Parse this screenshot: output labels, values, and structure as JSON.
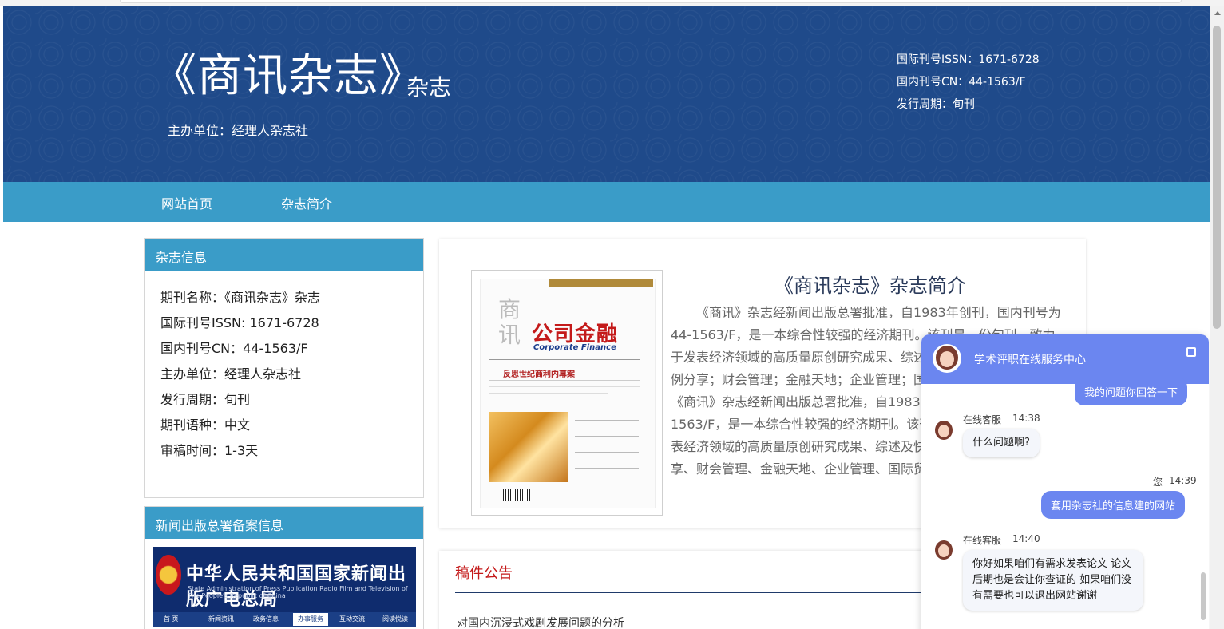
{
  "header": {
    "title": "《商讯杂志》",
    "title_suffix": "杂志",
    "sponsor": "主办单位：经理人杂志社",
    "issn": "国际刊号ISSN：1671-6728",
    "cn": "国内刊号CN：44-1563/F",
    "cycle": "发行周期：旬刊"
  },
  "nav": {
    "items": [
      "网站首页",
      "杂志简介"
    ]
  },
  "sidebar": {
    "info_title": "杂志信息",
    "info_items": [
      "期刊名称：《商讯杂志》杂志",
      "国际刊号ISSN: 1671-6728",
      "国内刊号CN：44-1563/F",
      "主办单位：经理人杂志社",
      "发行周期：旬刊",
      "期刊语种：中文",
      "审稿时间：1-3天"
    ],
    "record_title": "新闻出版总署备案信息",
    "gov_title": "中华人民共和国国家新闻出版广电总局",
    "gov_subtitle": "State Administration of Press Publication Radio Film and Television of The People's Republic of China",
    "gov_nav": [
      "首 页",
      "新闻资讯",
      "政务信息",
      "办事服务",
      "互动交流",
      "阅读悦读"
    ]
  },
  "intro": {
    "title": "《商讯杂志》杂志简介",
    "text": "《商讯》杂志经新闻出版总署批准，自1983年创刊，国内刊号为44-1563/F，是一本综合性较强的经济期刊。该刊是一份旬刊，致力于发表经济领域的高质量原创研究成果、综述及快报。主要栏目：案例分享；财会管理；金融天地；企业管理；国际贸易……杂志简介：《商讯》杂志经新闻出版总署批准，自1983年创刊，国内刊号为44-1563/F，是一本综合性较强的经济期刊。该刊是一份旬刊，致力于发表经济领域的高质量原创研究成果、综述及快报。主要栏目：案例分享、财会管理、金融天地、企业管理、国际贸易……稿源",
    "cover": {
      "shang": "商讯",
      "name": "公司金融",
      "en": "Corporate Finance",
      "headline": "反思世纪商利内幕案"
    }
  },
  "notice": {
    "title": "稿件公告",
    "items": [
      "对国内沉浸式戏剧发展问题的分析"
    ]
  },
  "chat": {
    "title": "学术评职在线服务中心",
    "messages": [
      {
        "from": "user",
        "text": "我的问题你回答一下"
      },
      {
        "from": "agent",
        "name": "在线客服",
        "time": "14:38",
        "text": "什么问题啊?"
      },
      {
        "from": "user",
        "name": "您",
        "time": "14:39",
        "text": "套用杂志社的信息建的网站"
      },
      {
        "from": "agent",
        "name": "在线客服",
        "time": "14:40",
        "text": "你好如果咱们有需求发表论文 论文后期也是会让你查证的 如果咱们没有需要也可以退出网站谢谢"
      }
    ]
  },
  "colors": {
    "header_bg": "#1f4a8a",
    "nav_bg": "#3a9cc8",
    "chat_accent": "#6b86f0",
    "notice_red": "#c41a1a"
  }
}
